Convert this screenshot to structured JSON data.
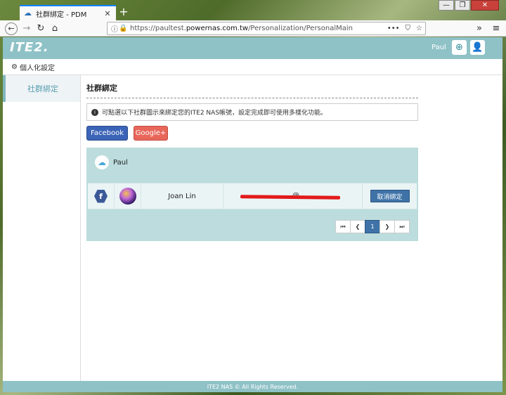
{
  "browser": {
    "tab_title": "社群綁定 - PDM",
    "url_prefix": "https://paultest.",
    "url_host": "powernas.com.tw",
    "url_path": "/Personalization/PersonalMain",
    "url_actions": "•••"
  },
  "header": {
    "logo": "ITE2.",
    "username": "Paul"
  },
  "breadcrumb": {
    "label": "個人化設定"
  },
  "sidebar": {
    "items": [
      {
        "label": "社群綁定"
      }
    ]
  },
  "main": {
    "title": "社群綁定",
    "notice": "可點選以下社群圖示來綁定您的ITE2 NAS帳號，設定完成即可使用多樣化功能。",
    "buttons": {
      "facebook": "Facebook",
      "google": "Google+"
    },
    "panel": {
      "account_name": "Paul",
      "rows": [
        {
          "provider": "f",
          "name": "Joan Lin",
          "email_visible": "@",
          "action": "取消綁定"
        }
      ]
    },
    "pagination": {
      "first": "⏮",
      "prev": "❮",
      "current": "1",
      "next": "❯",
      "last": "⏭"
    }
  },
  "footer": {
    "text": "ITE2 NAS © All Rights Reserved."
  }
}
